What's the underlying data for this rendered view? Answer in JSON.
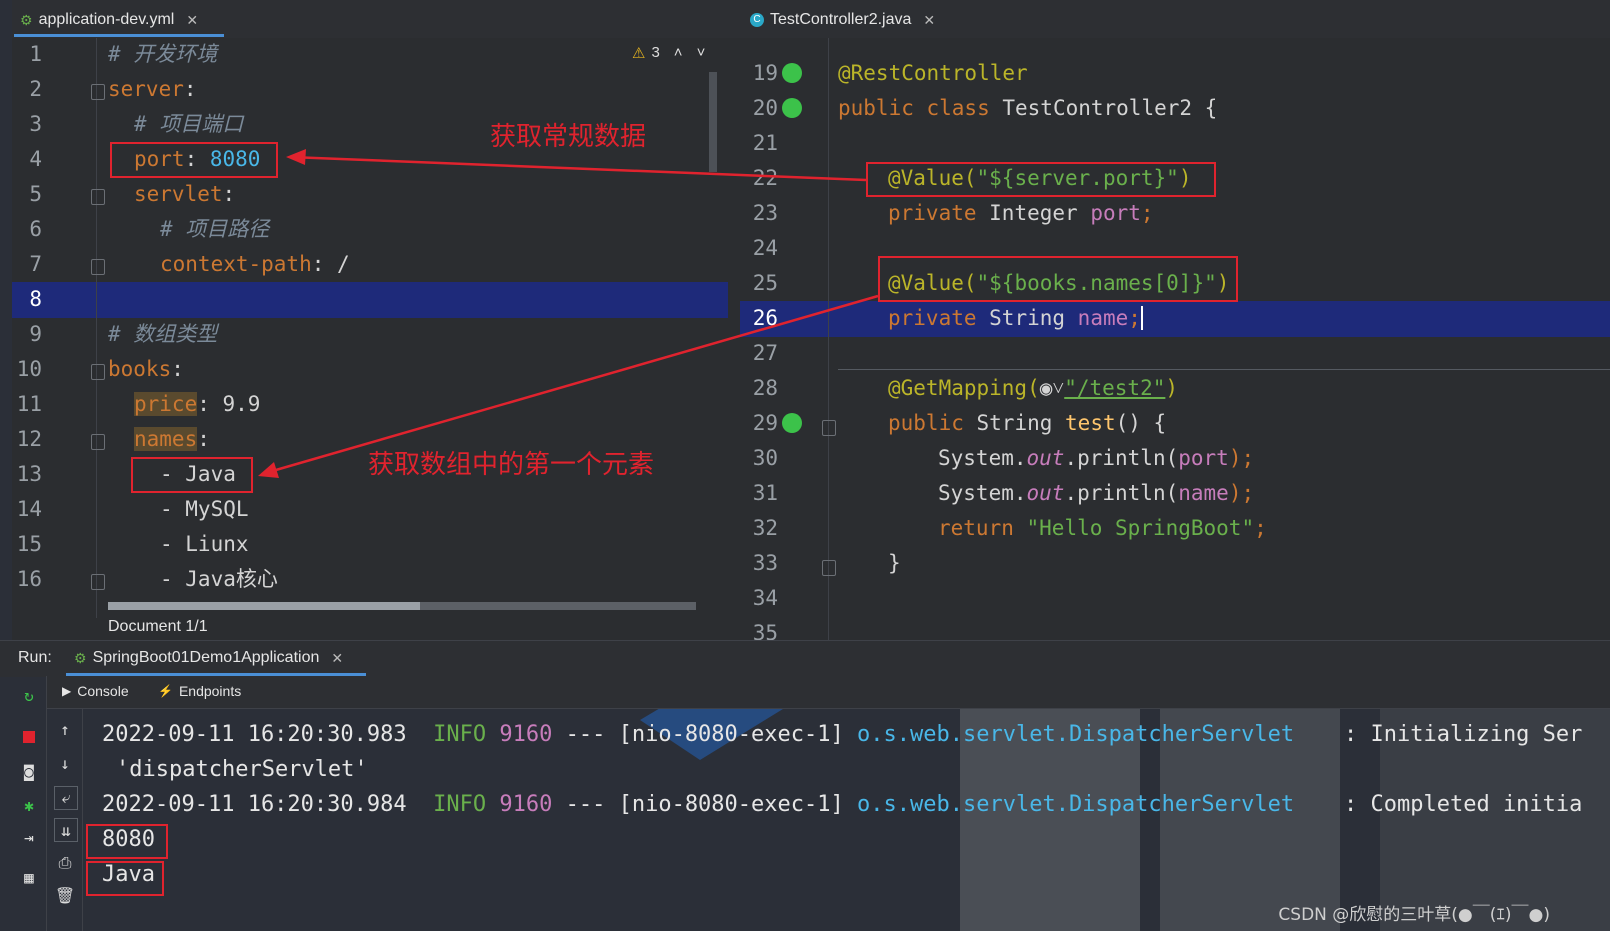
{
  "left_editor": {
    "tab_label": "application-dev.yml",
    "warning_count": "3",
    "status_text": "Document 1/1",
    "line_numbers": [
      "1",
      "2",
      "3",
      "4",
      "5",
      "6",
      "7",
      "8",
      "9",
      "10",
      "11",
      "12",
      "13",
      "14",
      "15",
      "16"
    ],
    "lines": {
      "l1": "# 开发环境",
      "l2_key": "server",
      "l2_colon": ":",
      "l3": "# 项目端口",
      "l4_key": "port",
      "l4_colon": ": ",
      "l4_val": "8080",
      "l5_key": "servlet",
      "l5_colon": ":",
      "l6": "# 项目路径",
      "l7_key": "context-path",
      "l7_rest": ": /",
      "l9": "# 数组类型",
      "l10_key": "books",
      "l10_colon": ":",
      "l11_key": "price",
      "l11_rest": ": 9.9",
      "l12_key": "names",
      "l12_colon": ":",
      "l13": "- Java",
      "l14": "- MySQL",
      "l15": "- Liunx",
      "l16": "- Java核心"
    }
  },
  "right_editor": {
    "tab_label": "TestController2.java",
    "line_numbers": [
      "19",
      "20",
      "21",
      "22",
      "23",
      "24",
      "25",
      "26",
      "27",
      "28",
      "29",
      "30",
      "31",
      "32",
      "33",
      "34",
      "35"
    ],
    "lines": {
      "l19": "@RestController",
      "l20_kw": "public class ",
      "l20_name": "TestController2 {",
      "l22_ann": "@Value(",
      "l22_str": "\"${server.port}\"",
      "l22_end": ")",
      "l23_kw": "private ",
      "l23_type": "Integer ",
      "l23_fld": "port",
      "l23_end": ";",
      "l25_ann": "@Value(",
      "l25_str": "\"${books.names[0]}\"",
      "l25_end": ")",
      "l26_kw": "private ",
      "l26_type": "String ",
      "l26_fld": "name",
      "l26_end": ";",
      "l28_ann": "@GetMapping(",
      "l28_icon": "◉˅",
      "l28_str": "\"/test2\"",
      "l28_end": ")",
      "l29_kw": "public ",
      "l29_type": "String ",
      "l29_meth": "test",
      "l29_end": "() {",
      "l30_a": "System.",
      "l30_out": "out",
      "l30_b": ".println(",
      "l30_fld": "port",
      "l30_end": ");",
      "l31_a": "System.",
      "l31_out": "out",
      "l31_b": ".println(",
      "l31_fld": "name",
      "l31_end": ");",
      "l32_kw": "return ",
      "l32_str": "\"Hello SpringBoot\"",
      "l32_end": ";",
      "l33": "}"
    }
  },
  "annotations": {
    "regular_data": "获取常规数据",
    "first_element": "获取数组中的第一个元素"
  },
  "run_panel": {
    "run_label": "Run:",
    "app_tab": "SpringBoot01Demo1Application",
    "console_tab": "Console",
    "endpoints_tab": "Endpoints"
  },
  "console": {
    "log1": {
      "ts": "2022-09-11 16:20:30.983",
      "level": "INFO",
      "pid": "9160",
      "thread": "--- [nio-8080-exec-1]",
      "cls": "o.s.web.servlet.DispatcherServlet",
      "msg": ": Initializing Ser"
    },
    "log1_cont": "'dispatcherServlet'",
    "log2": {
      "ts": "2022-09-11 16:20:30.984",
      "level": "INFO",
      "pid": "9160",
      "thread": "--- [nio-8080-exec-1]",
      "cls": "o.s.web.servlet.DispatcherServlet",
      "msg": ": Completed initia"
    },
    "out1": "8080",
    "out2": "Java"
  },
  "watermark": "CSDN @欣慰的三叶草(●￣(ｴ)￣●)",
  "colors": {
    "accent_red": "#e0232e",
    "highlight_line": "#1e2a7a",
    "tab_underline": "#4a8fd6"
  }
}
